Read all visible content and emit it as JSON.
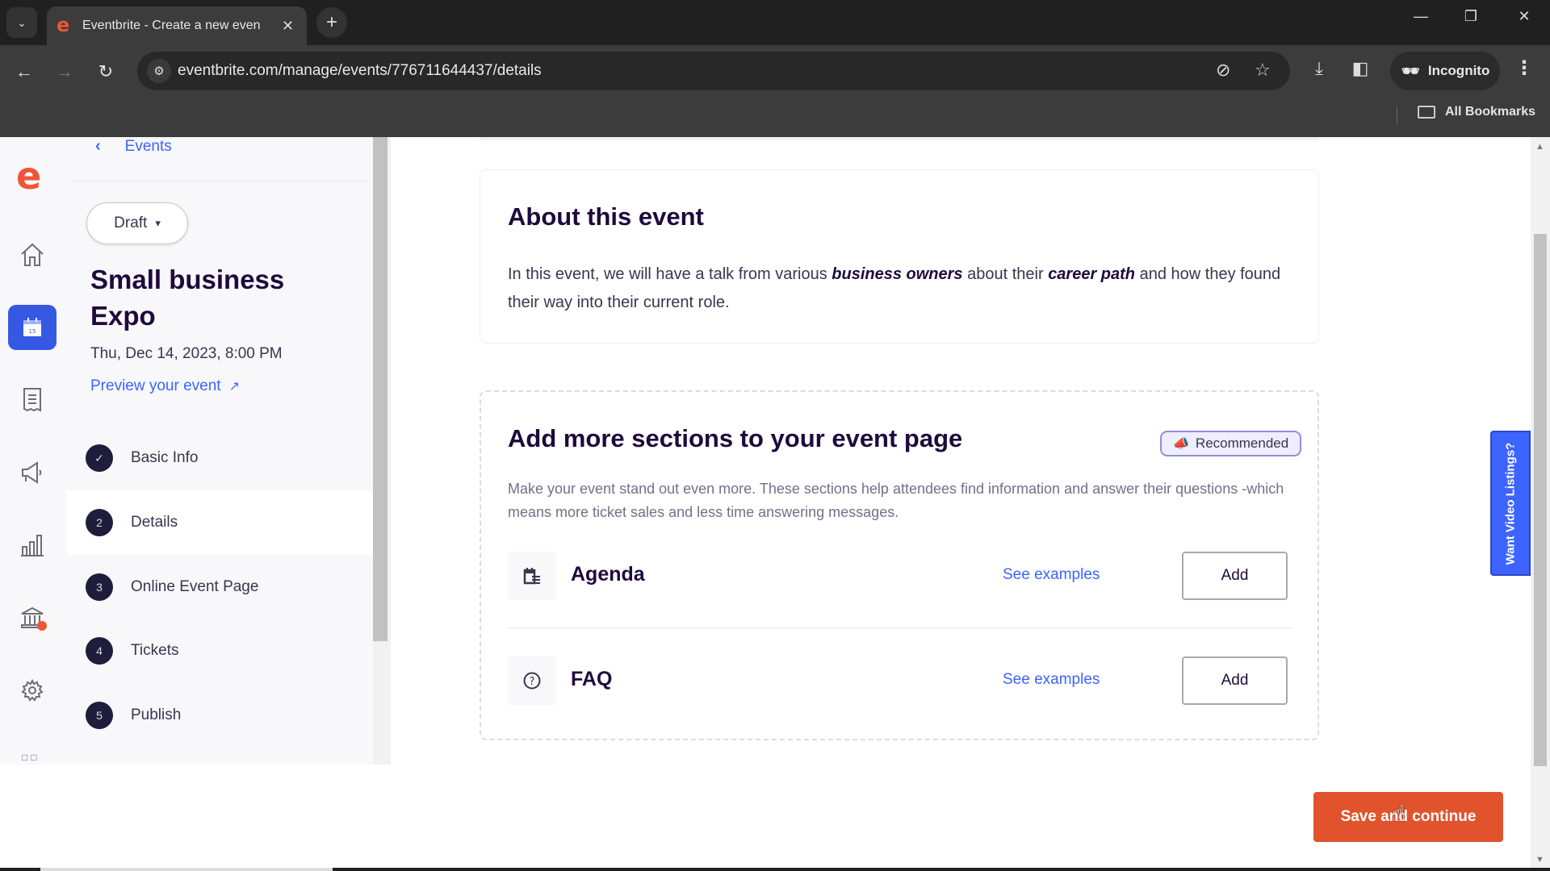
{
  "browser": {
    "tab_title": "Eventbrite - Create a new even",
    "url": "eventbrite.com/manage/events/776711644437/details",
    "incognito_label": "Incognito",
    "bookmarks_label": "All Bookmarks"
  },
  "rail": {
    "items": [
      {
        "icon": "home-icon"
      },
      {
        "icon": "calendar-icon",
        "active": true
      },
      {
        "icon": "orders-receipt-icon"
      },
      {
        "icon": "marketing-megaphone-icon"
      },
      {
        "icon": "reports-chart-icon"
      },
      {
        "icon": "finance-bank-icon",
        "notification": true
      },
      {
        "icon": "settings-gear-icon"
      },
      {
        "icon": "apps-grid-icon"
      }
    ]
  },
  "sidebar": {
    "back_label": "Events",
    "status_select": "Draft",
    "event_title": "Small business Expo",
    "event_datetime": "Thu, Dec 14, 2023, 8:00 PM",
    "preview_link": "Preview your event",
    "steps": [
      {
        "number": "✓",
        "label": "Basic Info",
        "state": "completed"
      },
      {
        "number": "2",
        "label": "Details",
        "state": "active"
      },
      {
        "number": "3",
        "label": "Online Event Page",
        "state": "pending"
      },
      {
        "number": "4",
        "label": "Tickets",
        "state": "pending"
      },
      {
        "number": "5",
        "label": "Publish",
        "state": "pending"
      }
    ]
  },
  "about": {
    "heading": "About this event",
    "text_parts": {
      "p1": "In this event, we will have a talk from various ",
      "b1": "business owners",
      "p2": " about their ",
      "b2": "career path",
      "p3": " and how they found their way into their current role."
    }
  },
  "sections": {
    "heading": "Add more sections to your event page",
    "badge": "Recommended",
    "description": "Make your event stand out even more. These sections help attendees find information and answer their questions -which means more ticket sales and less time answering messages.",
    "items": [
      {
        "name": "Agenda",
        "icon": "agenda-icon",
        "link": "See examples",
        "button": "Add"
      },
      {
        "name": "FAQ",
        "icon": "faq-question-icon",
        "link": "See examples",
        "button": "Add"
      }
    ]
  },
  "footer": {
    "save_button": "Save and continue"
  },
  "feedback_tab": "Want Video Listings?",
  "colors": {
    "brand_orange": "#f05537",
    "accent_blue": "#3d64ff",
    "primary_button": "#e0532c",
    "heading": "#1e0a3c"
  }
}
